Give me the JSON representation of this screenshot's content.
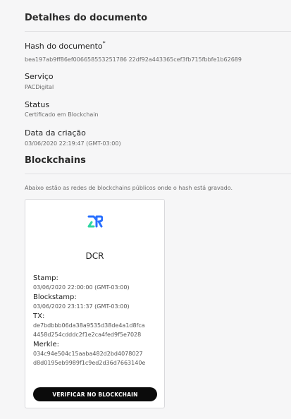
{
  "details": {
    "title": "Detalhes do documento",
    "hash_label": "Hash do documento",
    "hash_required_mark": "*",
    "hash_value": "bea197ab9ff86ef006658553251786 22df92a443365cef3fb715fbbfe1b62689",
    "service_label": "Serviço",
    "service_value": "PACDigital",
    "status_label": "Status",
    "status_value": "Certificado em Blockchain",
    "created_label": "Data da criação",
    "created_value": "03/06/2020 22:19:47 (GMT-03:00)"
  },
  "blockchains": {
    "title": "Blockchains",
    "note": "Abaixo estão as redes de blockchains públicos onde o hash está gravado.",
    "card": {
      "logo_icon": "dcr-logo-icon",
      "name": "DCR",
      "stamp_label": "Stamp:",
      "stamp_value": "03/06/2020 22:00:00 (GMT-03:00)",
      "blockstamp_label": "Blockstamp:",
      "blockstamp_value": "03/06/2020 23:11:37 (GMT-03:00)",
      "tx_label": "TX:",
      "tx_line1": "de7bdbbb06da38a9535d38de4a1d8fca",
      "tx_line2": "4458d254cdddc2f1e2ca4fed9f5e7028",
      "merkle_label": "Merkle:",
      "merkle_line1": "034c94e504c15aaba482d2bd4078027",
      "merkle_line2": "d8d0195eb9989f1c9ed2d36d7663140e",
      "verify_button": "VERIFICAR NO BLOCKCHAIN"
    }
  },
  "colors": {
    "background": "#f6f6f7",
    "button": "#0b0b0b",
    "logo_blue": "#2970ff",
    "logo_green": "#2ed6a1"
  }
}
